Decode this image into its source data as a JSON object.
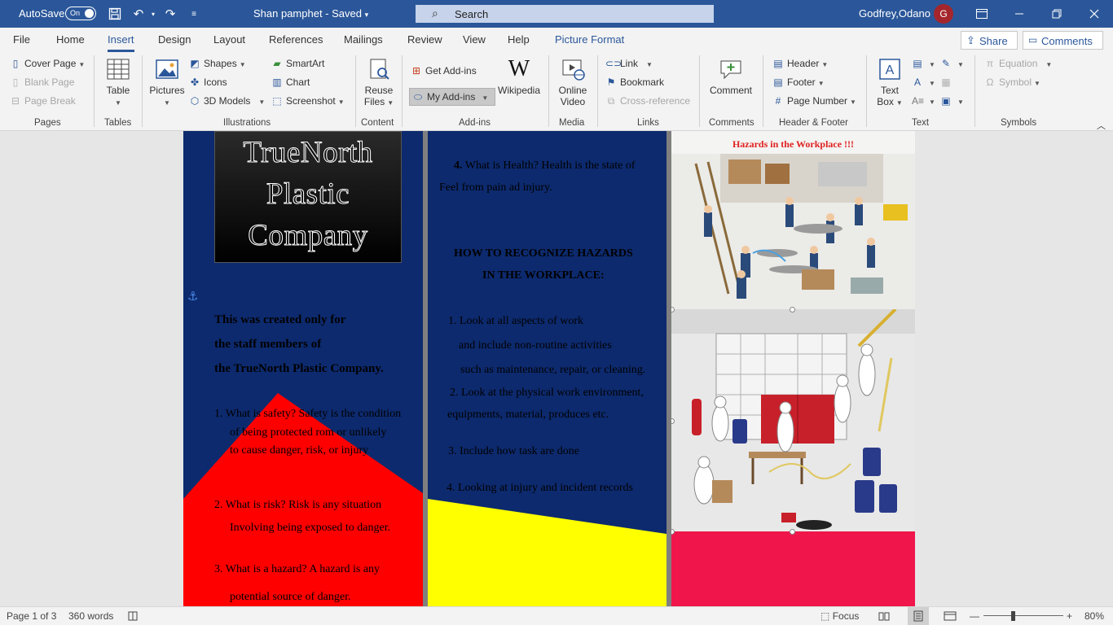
{
  "titlebar": {
    "autosave_label": "AutoSave",
    "autosave_state": "On",
    "doc_title": "Shan pamphet  -  Saved",
    "search_label": "Search",
    "user_name": "Godfrey,Odano",
    "avatar_initial": "G"
  },
  "menu": {
    "tabs": [
      "File",
      "Home",
      "Insert",
      "Design",
      "Layout",
      "References",
      "Mailings",
      "Review",
      "View",
      "Help",
      "Picture Format"
    ],
    "active_tab": "Insert",
    "share_label": "Share",
    "comments_label": "Comments"
  },
  "ribbon": {
    "pages": {
      "cover_page": "Cover Page",
      "blank_page": "Blank Page",
      "page_break": "Page Break",
      "label": "Pages"
    },
    "tables": {
      "table": "Table",
      "label": "Tables"
    },
    "illustrations": {
      "pictures": "Pictures",
      "shapes": "Shapes",
      "icons": "Icons",
      "models_3d": "3D Models",
      "smartart": "SmartArt",
      "chart": "Chart",
      "screenshot": "Screenshot",
      "label": "Illustrations"
    },
    "content": {
      "reuse_files_1": "Reuse",
      "reuse_files_2": "Files",
      "label": "Content"
    },
    "addins": {
      "get_addins": "Get Add-ins",
      "my_addins": "My Add-ins",
      "wikipedia": "Wikipedia",
      "label": "Add-ins"
    },
    "media": {
      "online_video_1": "Online",
      "online_video_2": "Video",
      "label": "Media"
    },
    "links": {
      "link": "Link",
      "bookmark": "Bookmark",
      "cross_reference": "Cross-reference",
      "label": "Links"
    },
    "comments": {
      "comment": "Comment",
      "label": "Comments"
    },
    "header_footer": {
      "header": "Header",
      "footer": "Footer",
      "page_number": "Page Number",
      "label": "Header & Footer"
    },
    "text": {
      "text_box_1": "Text",
      "text_box_2": "Box",
      "label": "Text"
    },
    "symbols": {
      "equation": "Equation",
      "symbol": "Symbol",
      "label": "Symbols"
    }
  },
  "document": {
    "logo_lines": [
      "TrueNorth",
      "Plastic",
      "Company"
    ],
    "col1_intro": [
      "This was created only for",
      "the staff members of",
      "the TrueNorth Plastic Company."
    ],
    "col1_items": [
      "1.   What is safety? Safety is the condition",
      "of being protected rom or unlikely",
      "to cause danger, risk, or injury",
      "2.   What is risk? Risk is any situation",
      "Involving being exposed to danger.",
      "3.   What is a hazard? A hazard is any",
      "potential source of danger."
    ],
    "col2_q4_num": "4.",
    "col2_q4_text": " What is Health? Health is the state of",
    "col2_q4_line2": "Feel from pain ad injury.",
    "col2_heading_1": "HOW TO RECOGNIZE HAZARDS",
    "col2_heading_2": "IN  THE WORKPLACE:",
    "col2_items": [
      "1. Look at all aspects of work",
      "and include non-routine activities",
      "such as maintenance, repair, or cleaning.",
      "2. Look at the physical work environment,",
      "equipments, material, produces etc.",
      "3. Include how task are done",
      "4. Looking at injury and incident records"
    ],
    "image1_caption": "Hazards in the Workplace !!!"
  },
  "statusbar": {
    "page": "Page 1 of 3",
    "words": "360 words",
    "focus": "Focus",
    "zoom": "80%"
  },
  "colors": {
    "title_blue": "#2b579a",
    "doc_navy": "#0d2a6e",
    "red": "#ff0000",
    "yellow": "#ffff00",
    "pink": "#f0154a"
  }
}
